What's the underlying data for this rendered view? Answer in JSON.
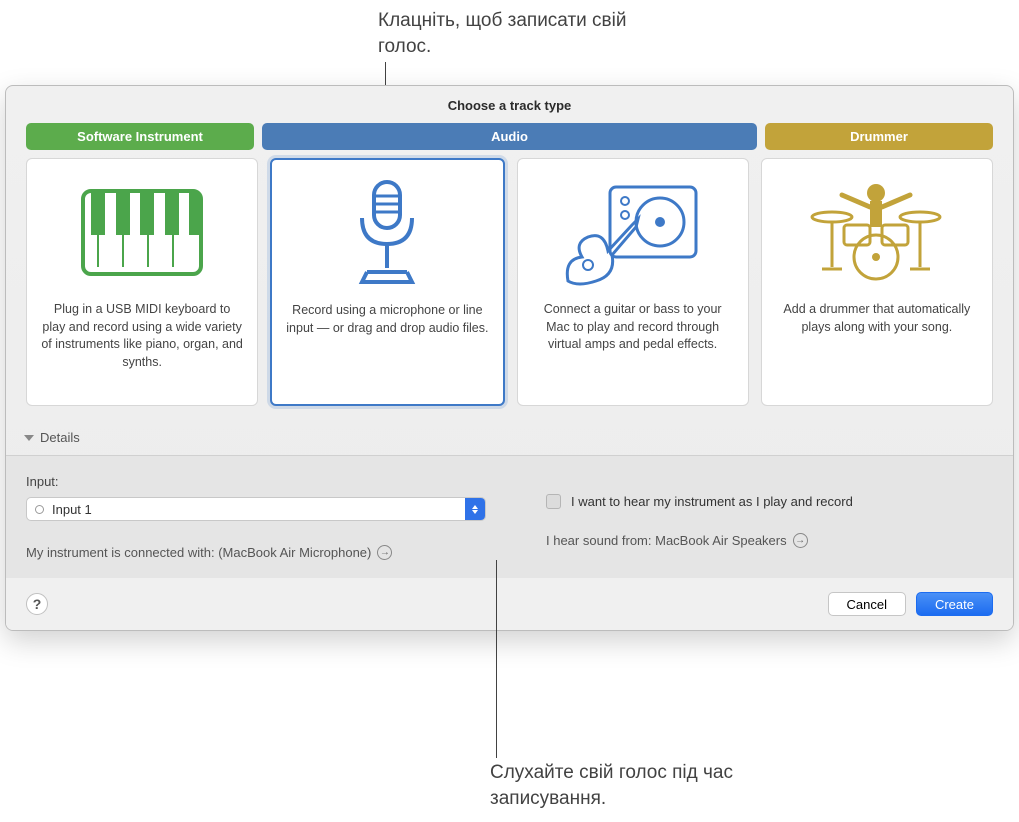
{
  "callouts": {
    "top": "Клацніть, щоб записати свій голос.",
    "bottom": "Слухайте свій голос під час записування."
  },
  "dialog": {
    "title": "Choose a track type",
    "tabs": {
      "software_instrument": "Software Instrument",
      "audio": "Audio",
      "drummer": "Drummer"
    },
    "cards": {
      "si_desc": "Plug in a USB MIDI keyboard to play and record using a wide variety of instruments like piano, organ, and synths.",
      "mic_desc": "Record using a microphone or line input — or drag and drop audio files.",
      "guitar_desc": "Connect a guitar or bass to your Mac to play and record through virtual amps and pedal effects.",
      "drummer_desc": "Add a drummer that automatically plays along with your song."
    },
    "details_label": "Details",
    "input": {
      "label": "Input:",
      "value": "Input 1",
      "connected": "My instrument is connected with: (MacBook Air Microphone)"
    },
    "monitor": {
      "checkbox_label": "I want to hear my instrument as I play and record",
      "output": "I hear sound from: MacBook Air Speakers"
    },
    "buttons": {
      "help": "?",
      "cancel": "Cancel",
      "create": "Create"
    }
  }
}
